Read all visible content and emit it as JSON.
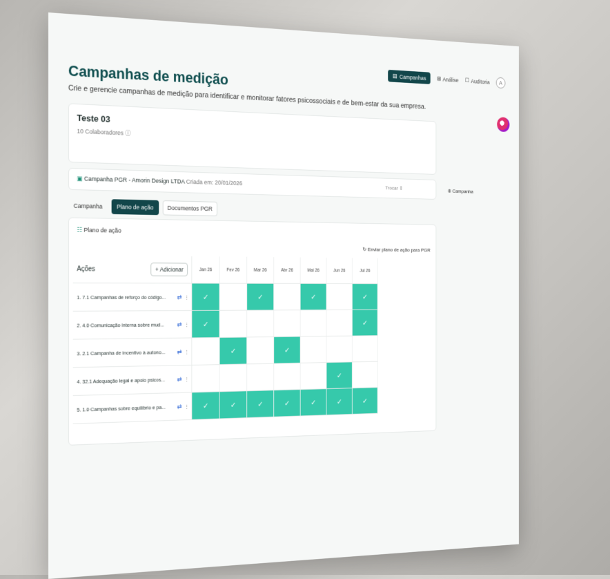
{
  "nav": {
    "campanhas": "Campanhas",
    "analise": "Análise",
    "auditoria": "Auditoria",
    "user_initial": "A"
  },
  "page": {
    "title": "Campanhas de medição",
    "subtitle": "Crie e gerencie campanhas de medição para identificar e monitorar fatores psicossociais e de bem-estar da sua empresa."
  },
  "group": {
    "name": "Teste 03",
    "count": "10 Colaboradores"
  },
  "campaign": {
    "name": "Campanha PGR - Amorin Design LTDA",
    "created": "Criada em: 20/01/2026",
    "select": "Trocar",
    "action": "Campanha"
  },
  "tabs": [
    "Campanha",
    "Plano de ação",
    "Documentos PGR"
  ],
  "plan": {
    "heading": "Plano de ação",
    "send_label": "Enviar plano de ação para PGR",
    "actions_header": "Ações",
    "add_label": "+ Adicionar",
    "months": [
      "Jan 26",
      "Fev 26",
      "Mar 26",
      "Abr 26",
      "Mai 26",
      "Jun 26",
      "Jul 26"
    ],
    "rows": [
      {
        "label": "1. 7.1 Campanhas de reforço do código...",
        "checks": [
          1,
          0,
          1,
          0,
          1,
          0,
          1
        ]
      },
      {
        "label": "2. 4.0 Comunicação interna sobre mud...",
        "checks": [
          1,
          0,
          0,
          0,
          0,
          0,
          1
        ]
      },
      {
        "label": "3. 2.1 Campanha de incentivo à autono...",
        "checks": [
          0,
          1,
          0,
          1,
          0,
          0,
          0
        ]
      },
      {
        "label": "4. 32.1 Adequação legal e apoio psicos...",
        "checks": [
          0,
          0,
          0,
          0,
          0,
          1,
          0
        ]
      },
      {
        "label": "5. 1.0 Campanhas sobre equilíbrio e pa...",
        "checks": [
          1,
          1,
          1,
          1,
          1,
          1,
          1
        ]
      }
    ]
  },
  "colors": {
    "primary": "#12464a",
    "check": "#36c9ab"
  }
}
